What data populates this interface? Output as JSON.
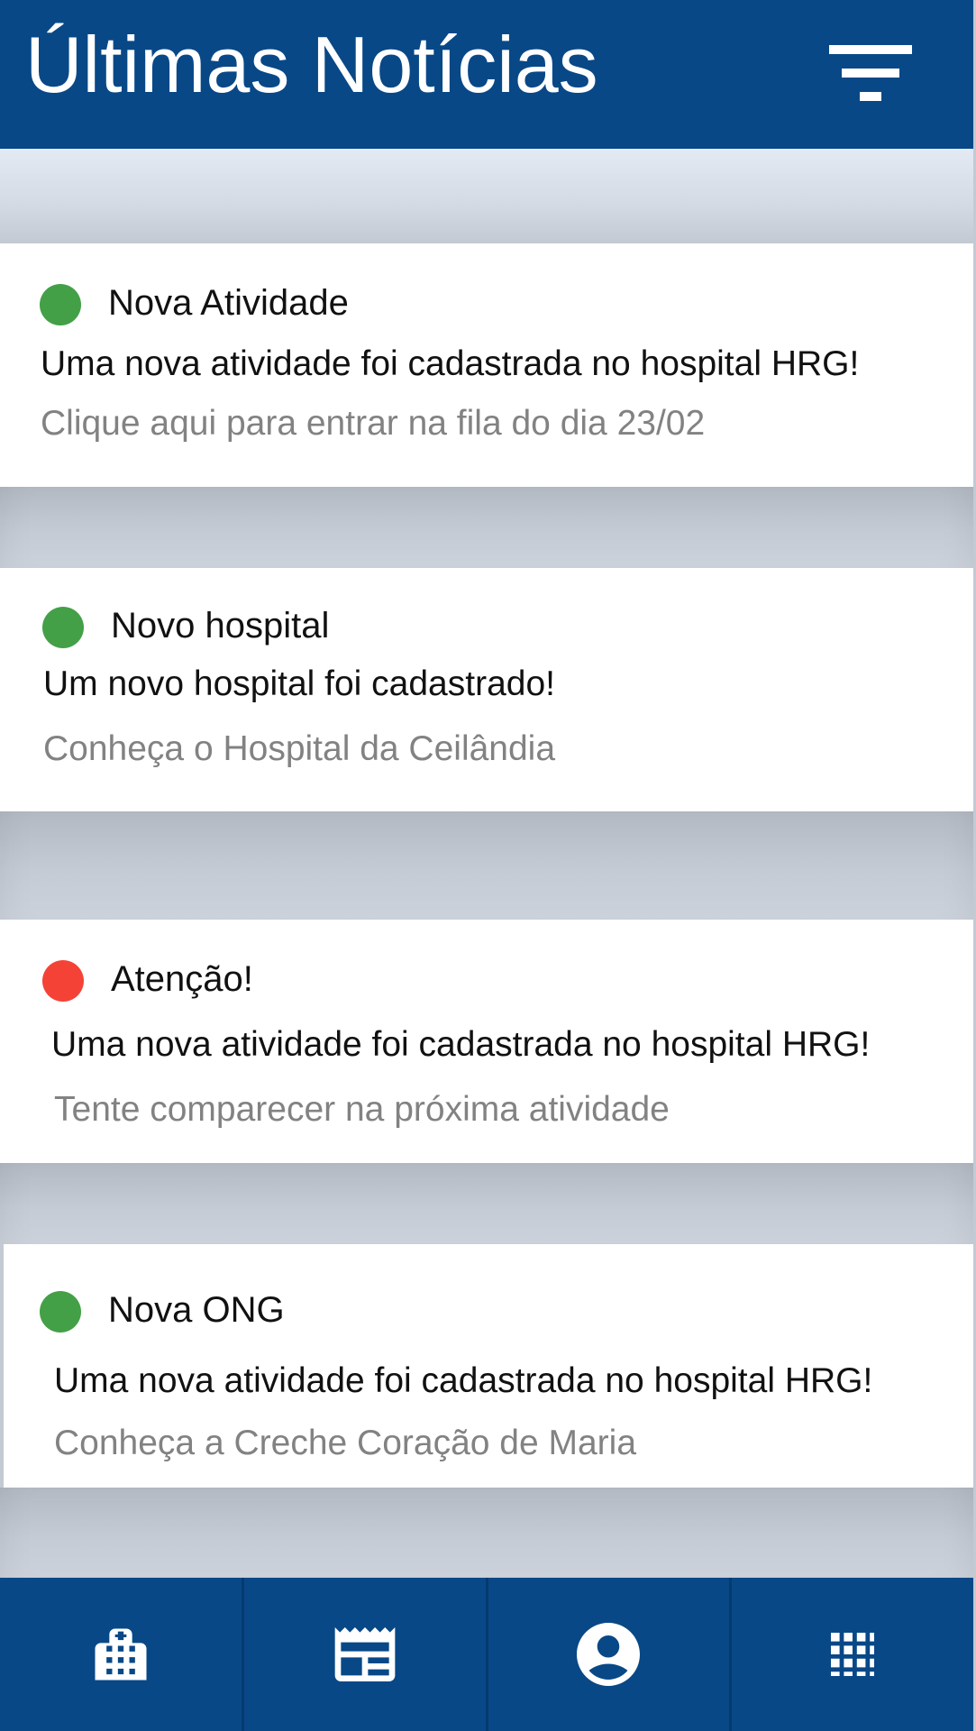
{
  "header": {
    "title": "Últimas Notícias",
    "filter_icon": "filter-list-icon"
  },
  "colors": {
    "primary": "#084887",
    "green_status": "#43a047",
    "red_status": "#f44336",
    "muted_text": "#828282"
  },
  "news": [
    {
      "status": "green",
      "status_icon": "status-dot-icon",
      "title": "Nova Atividade",
      "text": "Uma nova atividade foi cadastrada no hospital HRG!",
      "link": "Clique aqui para entrar na fila do dia 23/02"
    },
    {
      "status": "green",
      "status_icon": "status-dot-icon",
      "title": "Novo hospital",
      "text": "Um novo hospital foi cadastrado!",
      "link": "Conheça o Hospital da Ceilândia"
    },
    {
      "status": "red",
      "status_icon": "status-dot-icon",
      "title": "Atenção!",
      "text": "Uma nova atividade foi cadastrada no hospital HRG!",
      "link": "Tente comparecer na próxima atividade"
    },
    {
      "status": "green",
      "status_icon": "status-dot-icon",
      "title": "Nova ONG",
      "text": "Uma nova atividade foi cadastrada no hospital HRG!",
      "link": "Conheça a Creche Coração de Maria"
    }
  ],
  "bottom_nav": [
    {
      "icon": "hospital-icon"
    },
    {
      "icon": "news-icon"
    },
    {
      "icon": "account-icon"
    },
    {
      "icon": "apps-grid-icon"
    }
  ]
}
